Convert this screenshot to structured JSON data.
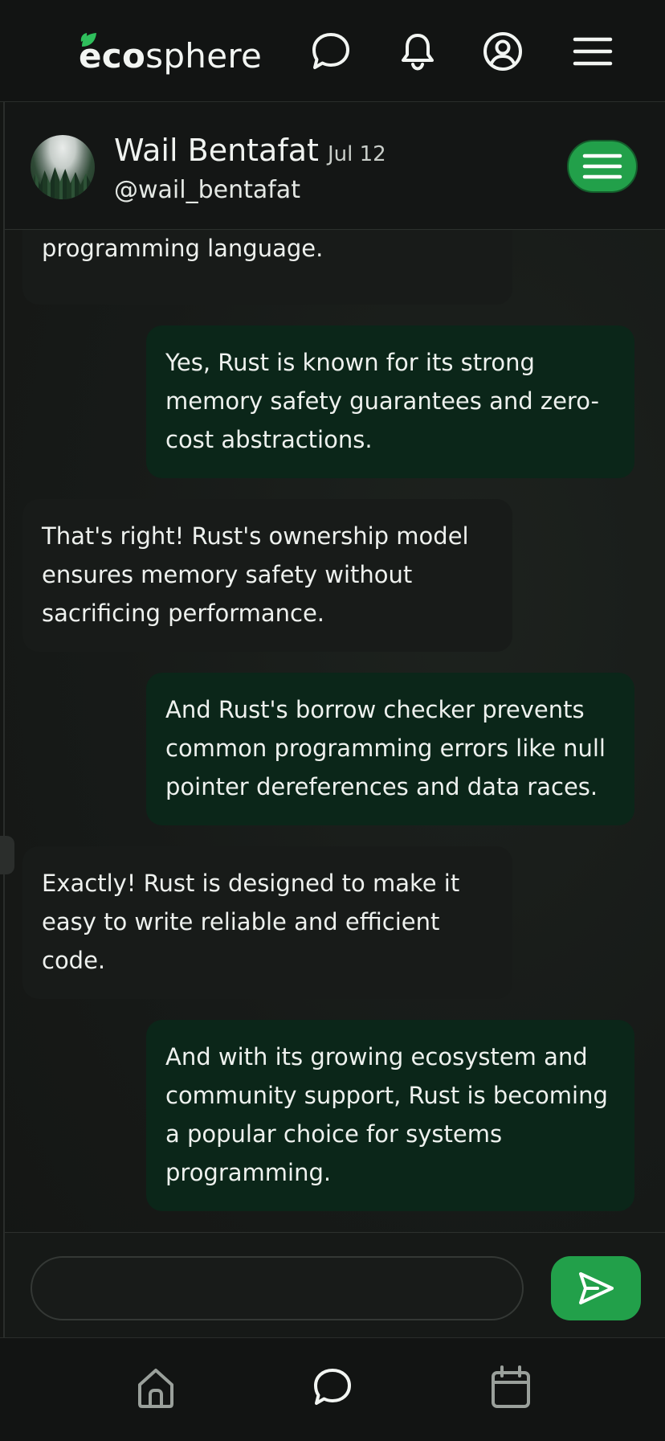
{
  "app": {
    "logo_bold": "eco",
    "logo_light": "sphere",
    "icons": {
      "chat": "chat-bubble-icon",
      "notifications": "bell-icon",
      "profile": "user-circle-icon",
      "menu": "hamburger-menu-icon"
    }
  },
  "chat": {
    "user_name": "Wail Bentafat",
    "date": "Jul 12",
    "handle": "@wail_bentafat",
    "messages": [
      {
        "from": "them",
        "text": "powerful and safe systems programming language."
      },
      {
        "from": "me",
        "text": "Yes, Rust is known for its strong memory safety guarantees and zero-cost abstractions."
      },
      {
        "from": "them",
        "text": "That's right! Rust's ownership model ensures memory safety without sacrificing performance."
      },
      {
        "from": "me",
        "text": "And Rust's borrow checker prevents common programming errors like null pointer dereferences and data races."
      },
      {
        "from": "them",
        "text": "Exactly! Rust is designed to make it easy to write reliable and efficient code."
      },
      {
        "from": "me",
        "text": "And with its growing ecosystem and community support, Rust is becoming a popular choice for systems programming."
      }
    ]
  },
  "composer": {
    "value": "",
    "placeholder": ""
  },
  "bottom_nav": {
    "items": [
      "home-icon",
      "chat-bubble-icon",
      "calendar-icon"
    ]
  },
  "colors": {
    "accent": "#22a04a",
    "outgoing_bubble": "#0b2619",
    "incoming_bubble": "#181b19"
  }
}
